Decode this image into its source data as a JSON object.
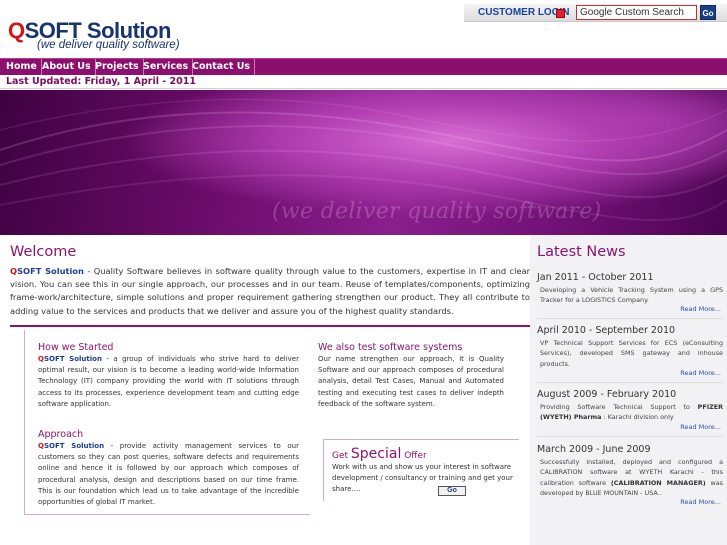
{
  "header": {
    "logo_q": "Q",
    "logo_rest": "SOFT Solution",
    "tagline": "(we deliver quality software)",
    "login_label": "CUSTOMER LOGIN",
    "search_value": "Google Custom Search",
    "search_go": "Go"
  },
  "nav": {
    "items": [
      "Home",
      "About Us",
      "Projects",
      "Services",
      "Contact Us"
    ]
  },
  "last_updated": "Last Updated: Friday, 1 April - 2011",
  "banner": {
    "watermark": "(we deliver quality software)"
  },
  "welcome": {
    "title": "Welcome",
    "brand_q": "Q",
    "brand_rest": "SOFT Solution",
    "text": " - Quality Software believes in software quality through value to the customers, expertise in IT and clear vision. You can see this in our single approach, our processes and in our team. Reuse of templates/components, optimizing frame-work/architecture, simple solutions and proper requirement gathering strengthen our product. They all contribute to adding value to the services and products that we deliver and assure you of the highest quality standards."
  },
  "how_we_started": {
    "title": "How we Started",
    "brand_q": "Q",
    "brand_rest": "SOFT Solution",
    "text": " - a group of individuals who strive hard to deliver optimal result, our vision is to become a leading world-wide Information Technology (IT) company providing the world with IT solutions through access to its processes, experience development team and cutting edge software application."
  },
  "approach": {
    "title": "Approach",
    "brand_q": "Q",
    "brand_rest": "SOFT Solution",
    "text": " - provide activity management services to our customers so they can post queries, software defects and requirements online and hence it is followed by our approach which composes of procedural analysis, design and descriptions based on our time frame. This is our foundation which lead us to take advantage of the incredible opportunities of global IT market."
  },
  "testing": {
    "title": "We also test software systems",
    "text": "Our name strengthen our approach, it is Quality Software and our approach composes of procedural analysis, detail Test Cases, Manual and Automated testing and executing test cases to deliver indepth feedback of the software system."
  },
  "special_offer": {
    "get": "Get ",
    "special": "Special",
    "offer": " Offer",
    "text": "Work with us and show us your interest in software development / consultancy or training and get your share....",
    "go_label": "Go"
  },
  "news": {
    "title": "Latest News",
    "read_more": "Read More...",
    "items": [
      {
        "date": "Jan 2011 - October 2011",
        "text": "Developing a Vehicle Tracking System using a GPS Tracker for a LOGISTICS Company."
      },
      {
        "date": "April 2010 - September 2010",
        "text": "VP Technical Support Services for ECS (eConsulting Services), developed SMS gateway and inhouse products."
      },
      {
        "date": "August 2009 - February 2010",
        "text_pre": "Providing Software Technical Support to ",
        "text_bold": "PFIZER (WYETH) Pharma",
        "text_post": " : Karachi division only"
      },
      {
        "date": "March 2009 - June 2009",
        "text_pre": "Successfully installed, deployed and configured a CALIBRATION software at WYETH Karachi - this calibration software ",
        "text_bold": "(CALIBRATION MANAGER)",
        "text_post": " was developed by BLUE MOUNTAIN - USA.."
      }
    ]
  },
  "colors": {
    "brand_purple": "#8a1470",
    "nav_bg": "#8c0f6e",
    "logo_blue": "#17346b",
    "logo_red": "#d21414"
  }
}
